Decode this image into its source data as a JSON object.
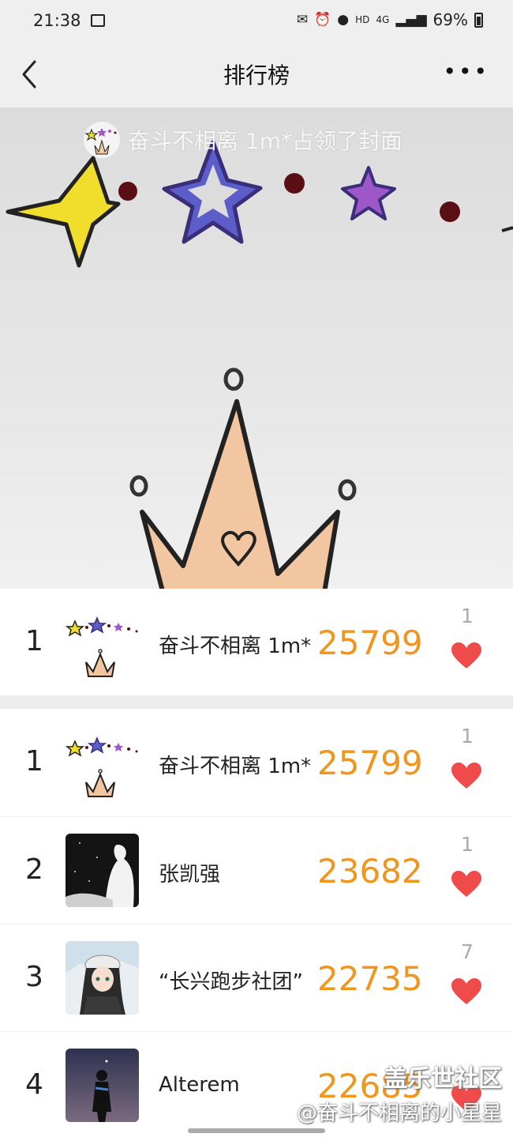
{
  "status_bar": {
    "time": "21:38",
    "network": "4G",
    "hd": "HD",
    "battery_percent": "69%"
  },
  "nav": {
    "back_icon": "chevron-left-icon",
    "title": "排行榜",
    "more_icon": "more-horizontal-icon"
  },
  "cover": {
    "banner_text": "奋斗不相离 1m*占领了封面"
  },
  "my_rank": {
    "rank": "1",
    "name": "奋斗不相离 1m*",
    "steps": "25799",
    "likes": "1"
  },
  "rankings": [
    {
      "rank": "1",
      "name": "奋斗不相离 1m*",
      "steps": "25799",
      "likes": "1",
      "avatar": "stars-crown"
    },
    {
      "rank": "2",
      "name": "张凯强",
      "steps": "23682",
      "likes": "1",
      "avatar": "dark-silhouette"
    },
    {
      "rank": "3",
      "name": "“长兴跑步社团”",
      "steps": "22735",
      "likes": "7",
      "avatar": "anime-girl"
    },
    {
      "rank": "4",
      "name": "Alterem",
      "steps": "22685",
      "likes": "",
      "avatar": "night-figure"
    }
  ],
  "watermark": {
    "line1": "盖乐世社区",
    "line2": "@奋斗不相离的小星星"
  },
  "colors": {
    "steps": "#f0951e",
    "heart": "#f04b4b",
    "background_bar": "#efefef"
  }
}
